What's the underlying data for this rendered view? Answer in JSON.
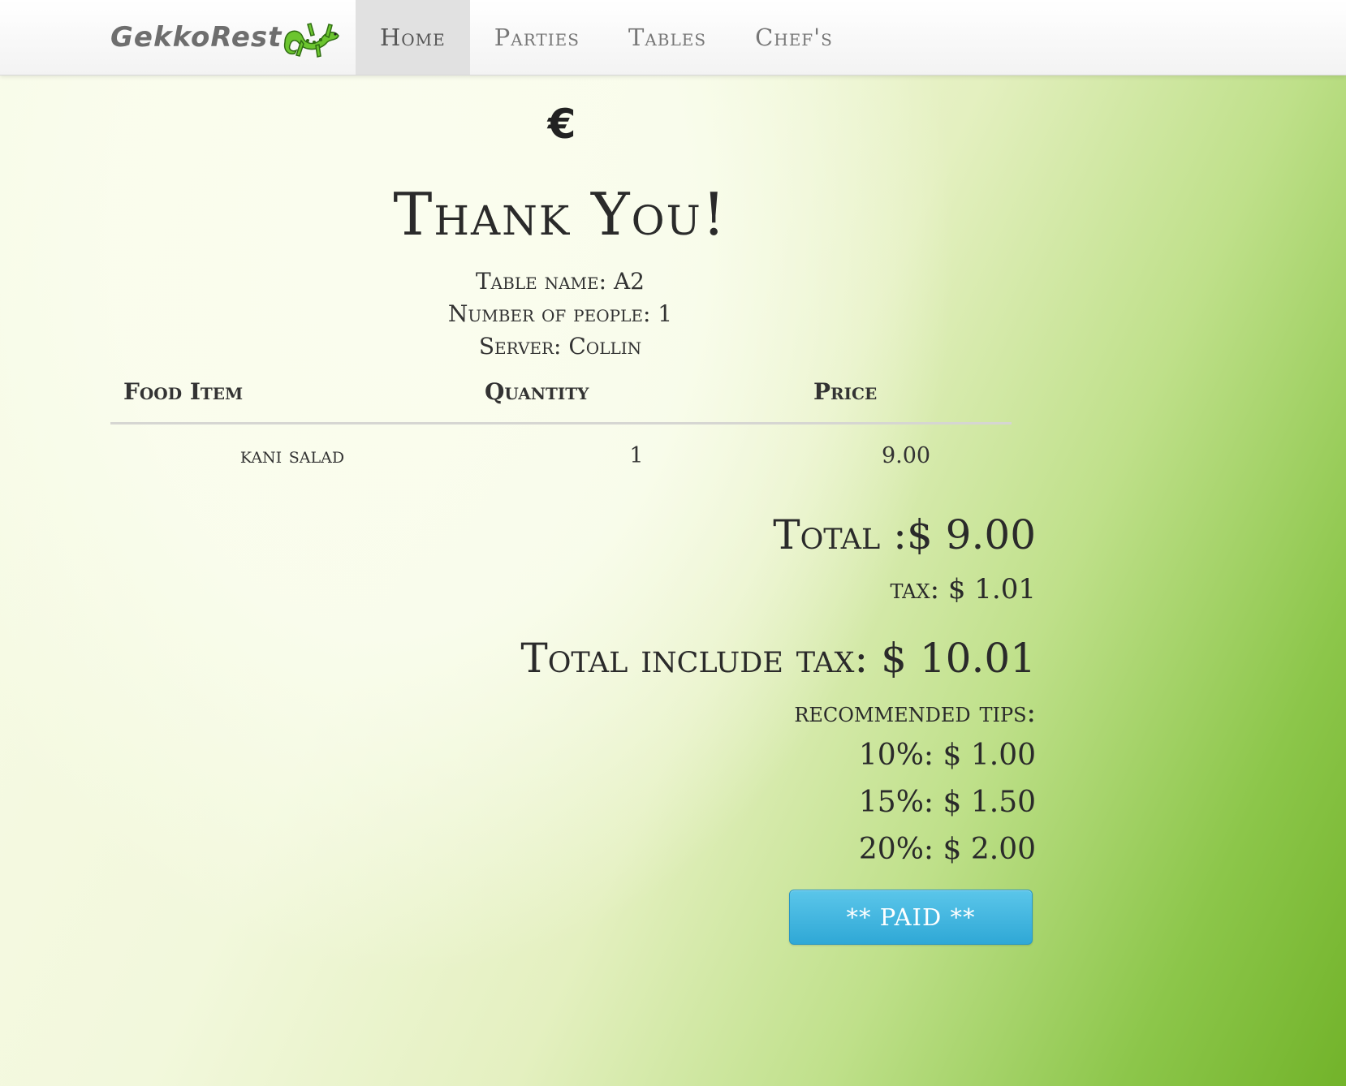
{
  "navbar": {
    "brand": "GekkoRest",
    "brand_icon": "gecko-icon",
    "items": [
      {
        "label": "Home",
        "active": true
      },
      {
        "label": "Parties",
        "active": false
      },
      {
        "label": "Tables",
        "active": false
      },
      {
        "label": "Chef's",
        "active": false
      }
    ]
  },
  "receipt": {
    "currency_symbol": "€",
    "title": "Thank You!",
    "table_name": "Table name: A2",
    "number_of_people": "Number of people: 1",
    "server": "Server: Collin",
    "columns": [
      "Food Item",
      "Quantity",
      "Price"
    ],
    "rows": [
      {
        "item": "kani salad",
        "quantity": "1",
        "price": "9.00"
      }
    ],
    "total": "Total :$ 9.00",
    "tax": "tax: $ 1.01",
    "total_include_tax": "Total include tax: $ 10.01",
    "recommended_tips_label": "recommended tips:",
    "tips": [
      "10%: $ 1.00",
      "15%: $ 1.50",
      "20%: $ 2.00"
    ],
    "paid_button": "** PAID **"
  },
  "colors": {
    "button": "#2fa8d6",
    "gecko": "#6cc52f",
    "nav_active_bg": "#e1e1e1"
  }
}
